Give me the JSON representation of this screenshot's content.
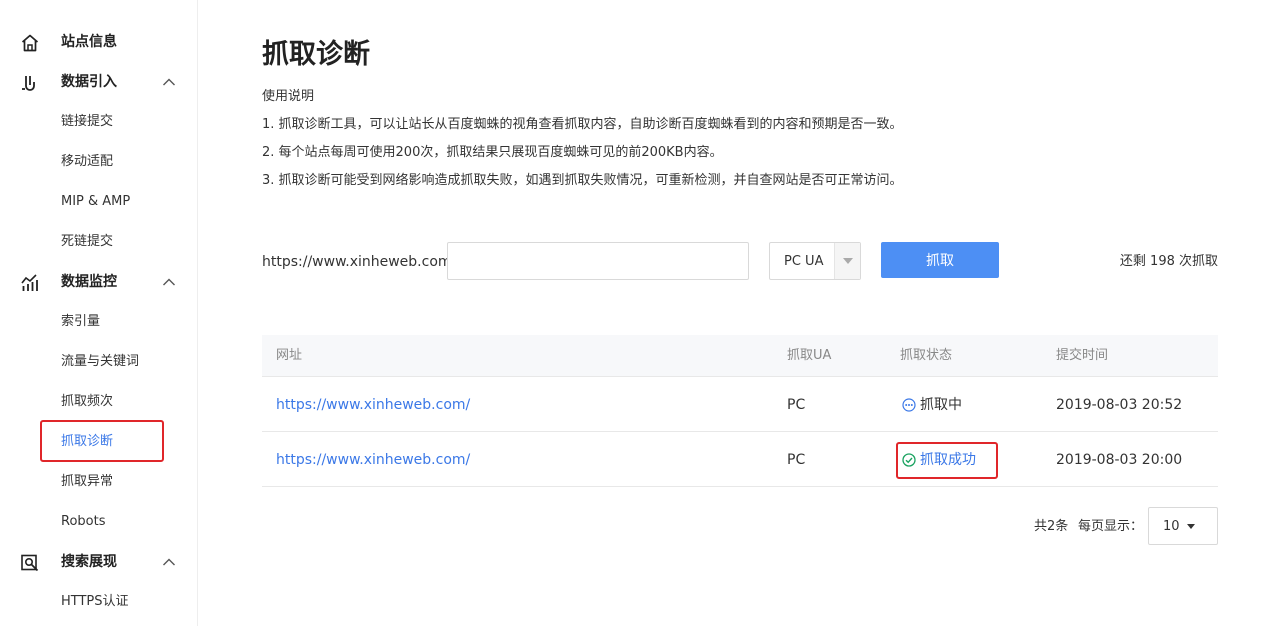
{
  "sidebar": {
    "groups": [
      {
        "label": "站点信息",
        "icon": "home-icon"
      },
      {
        "label": "数据引入",
        "icon": "data-import-icon",
        "expanded": true,
        "items": [
          "链接提交",
          "移动适配",
          "MIP & AMP",
          "死链提交"
        ]
      },
      {
        "label": "数据监控",
        "icon": "chart-icon",
        "expanded": true,
        "items": [
          "索引量",
          "流量与关键词",
          "抓取频次",
          "抓取诊断",
          "抓取异常",
          "Robots"
        ]
      },
      {
        "label": "搜索展现",
        "icon": "search-display-icon",
        "expanded": true,
        "items": [
          "HTTPS认证"
        ]
      }
    ],
    "active_item": "抓取诊断"
  },
  "main": {
    "title": "抓取诊断",
    "instructions_title": "使用说明",
    "instructions": [
      "1. 抓取诊断工具，可以让站长从百度蜘蛛的视角查看抓取内容，自助诊断百度蜘蛛看到的内容和预期是否一致。",
      "2. 每个站点每周可使用200次，抓取结果只展现百度蜘蛛可见的前200KB内容。",
      "3. 抓取诊断可能受到网络影响造成抓取失败，如遇到抓取失败情况，可重新检测，并自查网站是否可正常访问。"
    ],
    "form": {
      "url_prefix": "https://www.xinheweb.com/",
      "url_value": "",
      "ua_selected": "PC UA",
      "submit_label": "抓取",
      "remaining_text": "还剩 198 次抓取"
    },
    "table": {
      "headers": [
        "网址",
        "抓取UA",
        "抓取状态",
        "提交时间"
      ],
      "rows": [
        {
          "url": "https://www.xinheweb.com/",
          "ua": "PC",
          "status": "抓取中",
          "status_icon": "more-circle-icon",
          "time": "2019-08-03 20:52"
        },
        {
          "url": "https://www.xinheweb.com/",
          "ua": "PC",
          "status": "抓取成功",
          "status_icon": "check-circle-icon",
          "time": "2019-08-03 20:00"
        }
      ]
    },
    "pagination": {
      "total_text": "共2条",
      "page_size_label": "每页显示：",
      "page_size": "10"
    }
  },
  "colors": {
    "accent": "#4d8ff4",
    "link": "#3b78e7",
    "highlight": "#e0262a",
    "success": "#1aa260"
  }
}
